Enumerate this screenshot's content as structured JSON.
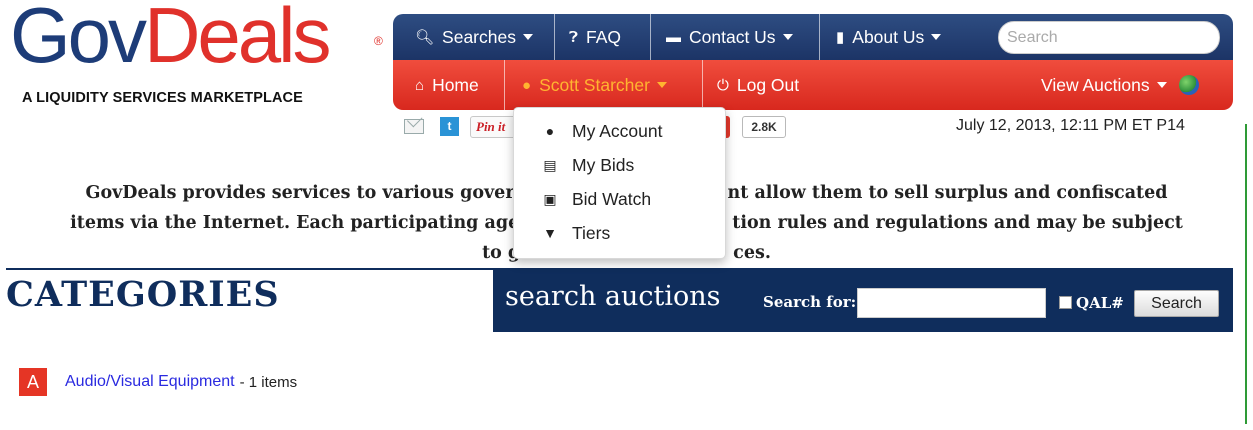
{
  "logo": {
    "gov": "Gov",
    "deals": "Deals",
    "reg": "®",
    "tagline": "A LIQUIDITY SERVICES MARKETPLACE"
  },
  "topnav": {
    "searches": "Searches",
    "faq": "FAQ",
    "contact": "Contact Us",
    "about": "About Us",
    "search_placeholder": "Search"
  },
  "rednav": {
    "home": "Home",
    "user": "Scott Starcher",
    "logout": "Log Out",
    "view_auctions": "View Auctions"
  },
  "social": {
    "pin": "Pin it",
    "count": "2.8K"
  },
  "datetime": "July 12, 2013, 12:11 PM ET   P14",
  "intro": {
    "line1": "GovDeals provides services to various gover",
    "line1b": "nt allow them to sell surplus and confiscated",
    "line2": "items via the Internet. Each participating age",
    "line2b": "tion rules and regulations and may be subject",
    "line3": "to g",
    "line3b": "ces."
  },
  "categories": {
    "title": "CATEGORIES",
    "items": [
      {
        "letter": "A",
        "name": "Audio/Visual Equipment",
        "count": "- 1 items"
      }
    ]
  },
  "search_auctions": {
    "title": "search auctions",
    "label": "Search for:",
    "value": "",
    "qal": "QAL#",
    "button": "Search"
  },
  "dropdown": {
    "items": [
      {
        "label": "My Account",
        "icon": "user-icon"
      },
      {
        "label": "My Bids",
        "icon": "cart-icon"
      },
      {
        "label": "Bid Watch",
        "icon": "camera-icon"
      },
      {
        "label": "Tiers",
        "icon": "filter-icon"
      }
    ]
  }
}
